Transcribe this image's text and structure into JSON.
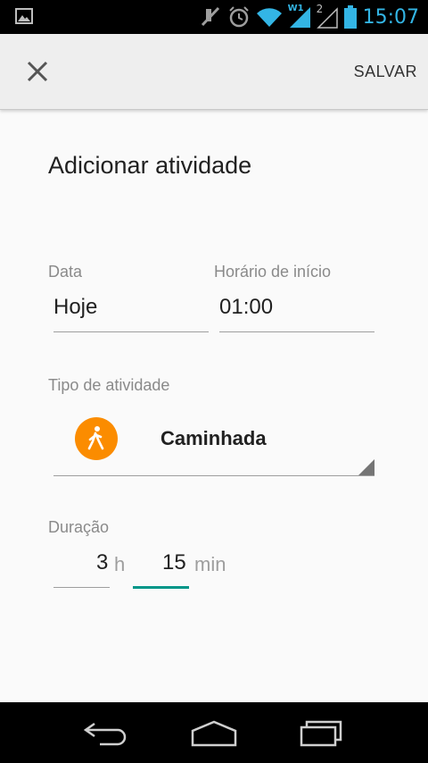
{
  "status_bar": {
    "time": "15:07",
    "icons": [
      "image-icon",
      "mute-icon",
      "alarm-icon",
      "wifi-icon",
      "signal-1-icon",
      "signal-2-icon",
      "battery-icon"
    ],
    "signal_labels": {
      "w1": "W1",
      "sim2": "2"
    },
    "accent_color": "#33b5e5"
  },
  "app_bar": {
    "close_icon": "close-icon",
    "save_label": "SALVAR"
  },
  "form": {
    "title": "Adicionar atividade",
    "date": {
      "label": "Data",
      "value": "Hoje"
    },
    "start_time": {
      "label": "Horário de início",
      "value": "01:00"
    },
    "activity_type": {
      "label": "Tipo de atividade",
      "value": "Caminhada",
      "icon": "walking-icon",
      "icon_color": "#fb8c00"
    },
    "duration": {
      "label": "Duração",
      "hours": {
        "value": "3",
        "unit": "h"
      },
      "minutes": {
        "value": "15",
        "unit": "min",
        "focused": true,
        "underline_color": "#009688"
      }
    }
  },
  "nav_bar": {
    "icons": [
      "back-icon",
      "home-icon",
      "recent-apps-icon"
    ]
  }
}
